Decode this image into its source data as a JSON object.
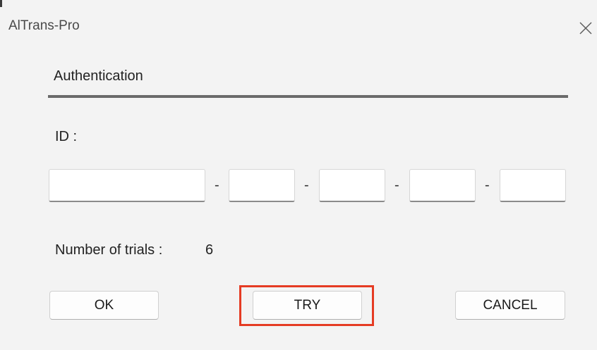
{
  "window": {
    "title": "AlTrans-Pro",
    "close_icon": "close-icon"
  },
  "section": {
    "title": "Authentication"
  },
  "id_field": {
    "label": "ID :",
    "separator": "-",
    "segments": [
      "",
      "",
      "",
      "",
      ""
    ]
  },
  "trials": {
    "label": "Number of trials :",
    "value": "6"
  },
  "buttons": {
    "ok": "OK",
    "try": "TRY",
    "cancel": "CANCEL"
  },
  "colors": {
    "highlight": "#e53b23",
    "background": "#f3f3f3"
  }
}
